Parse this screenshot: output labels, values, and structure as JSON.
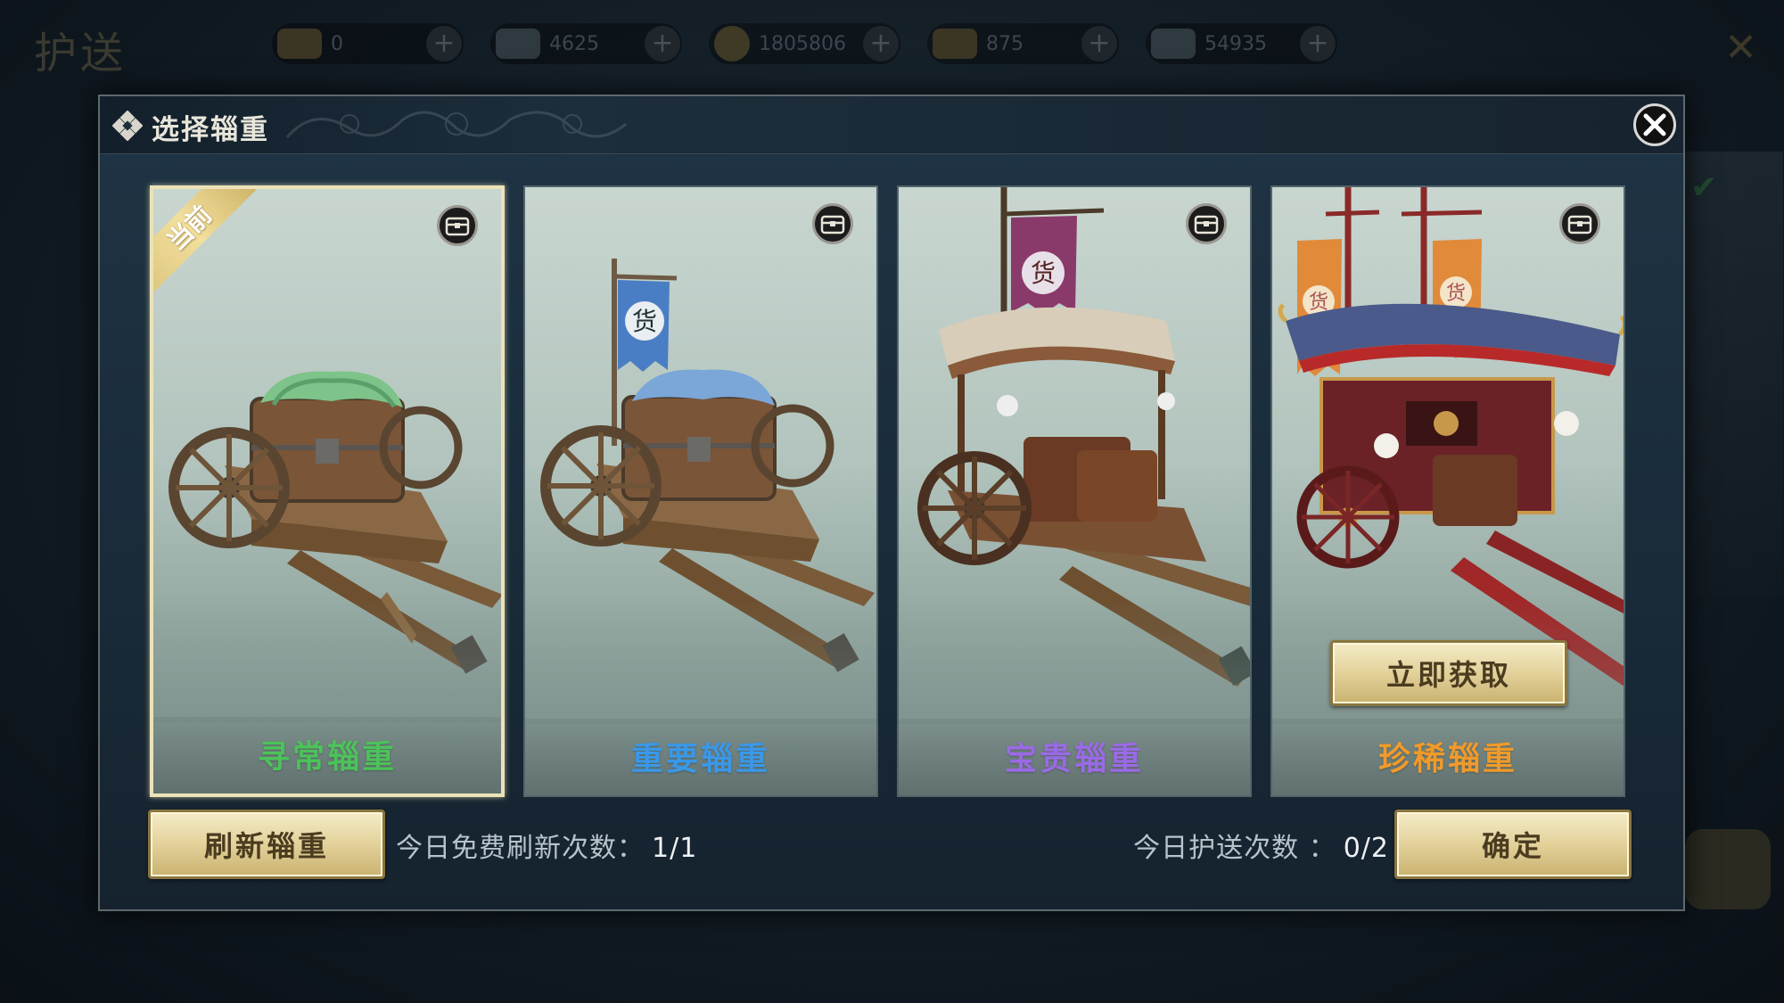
{
  "background": {
    "title": "护送",
    "currencies": [
      {
        "icon": "gold-ingot-icon",
        "value": "0"
      },
      {
        "icon": "silver-ingot-icon",
        "value": "4625"
      },
      {
        "icon": "coin-icon",
        "value": "1805806"
      },
      {
        "icon": "gold-ingot-icon",
        "value": "875"
      },
      {
        "icon": "treasure-icon",
        "value": "54935"
      }
    ]
  },
  "dialog": {
    "title": "选择辎重",
    "close_icon": "close-icon"
  },
  "cards": [
    {
      "name": "寻常辎重",
      "color": "#4cc25a",
      "selected": true,
      "ribbon": "当前",
      "cart": "green-cloth-cart"
    },
    {
      "name": "重要辎重",
      "color": "#3a98e8",
      "selected": false,
      "ribbon": "",
      "cart": "blue-banner-cart"
    },
    {
      "name": "宝贵辎重",
      "color": "#9a6ae6",
      "selected": false,
      "ribbon": "",
      "cart": "purple-covered-cart"
    },
    {
      "name": "珍稀辎重",
      "color": "#f09a2a",
      "selected": false,
      "ribbon": "",
      "cart": "orange-palace-cart",
      "claim_label": "立即获取"
    }
  ],
  "banner_char": "货",
  "footer": {
    "refresh_label": "刷新辎重",
    "free_refresh_label": "今日免费刷新次数：",
    "free_refresh_value": "1/1",
    "escort_label": "今日护送次数 ：",
    "escort_value": "0/2",
    "confirm_label": "确定"
  }
}
